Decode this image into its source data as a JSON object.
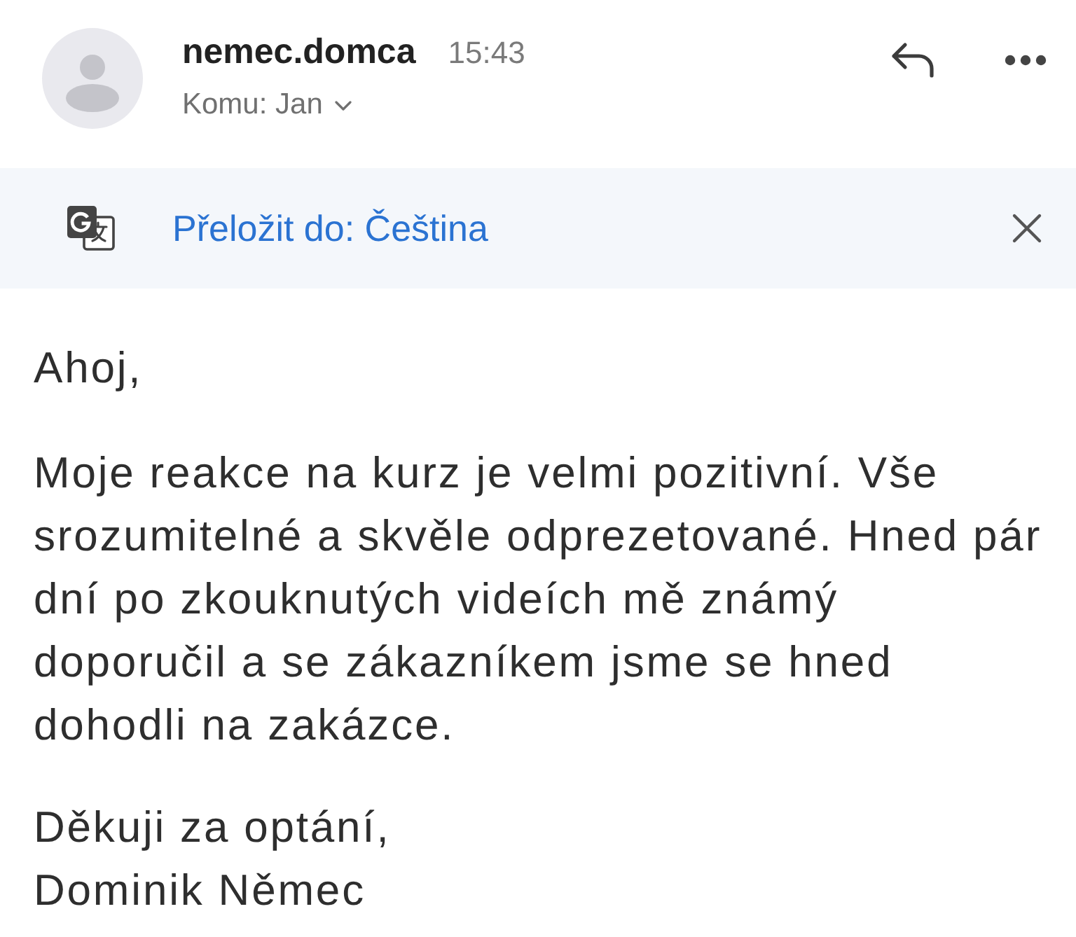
{
  "header": {
    "sender": "nemec.domca",
    "time": "15:43",
    "recipient": "Komu: Jan"
  },
  "translate_bar": {
    "label": "Přeložit do: Čeština"
  },
  "body": {
    "greeting": "Ahoj,",
    "paragraphs": [
      "Moje reakce na kurz je velmi pozitivní. Vše srozumitelné a skvěle odprezetované. Hned pár dní po zkouknutých videích mě známý doporučil a se zákazníkem jsme se hned dohodli na zakázce."
    ],
    "closing": "Děkuji za optání,",
    "signature": "Dominik Němec"
  }
}
